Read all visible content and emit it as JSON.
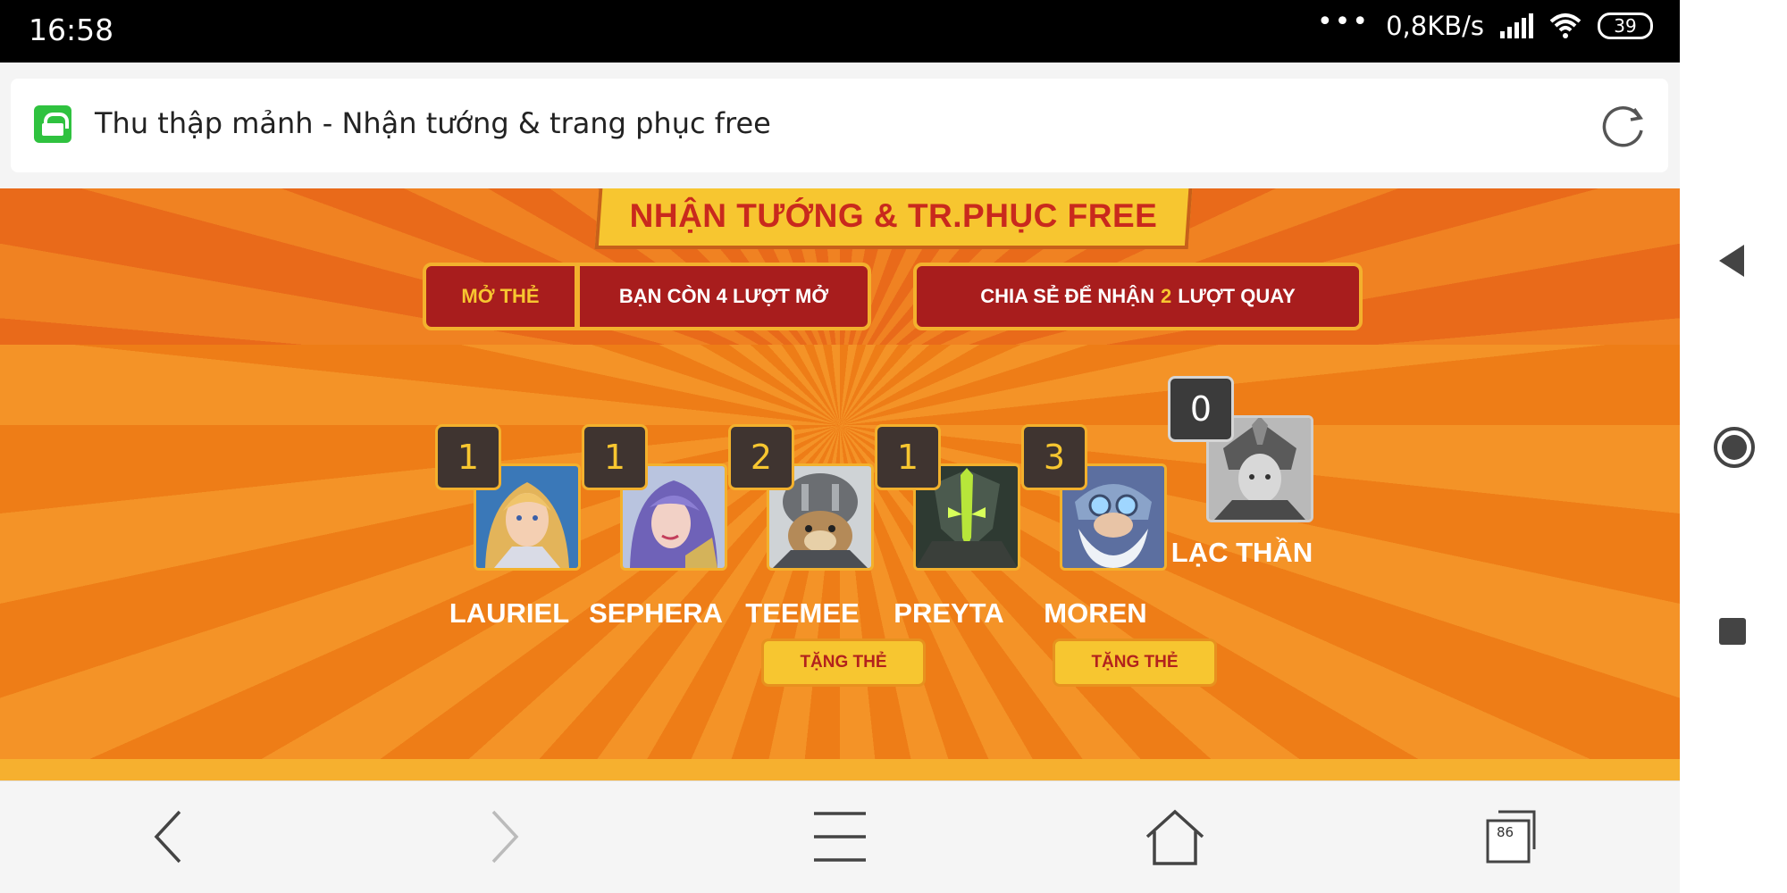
{
  "status_bar": {
    "time": "16:58",
    "dots": "•••",
    "speed": "0,8KB/s",
    "battery": "39"
  },
  "address_bar": {
    "title": "Thu thập mảnh - Nhận tướng & trang phục free"
  },
  "page": {
    "banner": "NHẬN TƯỚNG & TR.PHỤC FREE",
    "open_card": {
      "label": "MỞ THẺ",
      "remaining": "BẠN CÒN 4 LƯỢT MỞ"
    },
    "share": {
      "prefix": "CHIA SẺ ĐỂ NHẬN",
      "count": "2",
      "suffix": "LƯỢT QUAY"
    },
    "heroes": [
      {
        "name": "LAURIEL",
        "count": "1"
      },
      {
        "name": "SEPHERA",
        "count": "1"
      },
      {
        "name": "TEEMEE",
        "count": "2"
      },
      {
        "name": "PREYTA",
        "count": "1"
      },
      {
        "name": "MOREN",
        "count": "3"
      },
      {
        "name": "LẠC THẦN",
        "count": "0",
        "locked": true
      }
    ],
    "gift_label": "TẶNG THẺ"
  },
  "bottom_bar": {
    "tab_count": "86",
    "icons": [
      "back-icon",
      "forward-icon",
      "menu-icon",
      "home-icon",
      "tabs-icon"
    ]
  },
  "system_nav": {
    "icons": [
      "nav-back-icon",
      "nav-home-icon",
      "nav-recent-icon"
    ]
  },
  "colors": {
    "accent_red": "#a81d1d",
    "accent_gold": "#f7c630",
    "background_orange": "#ee7d17"
  }
}
